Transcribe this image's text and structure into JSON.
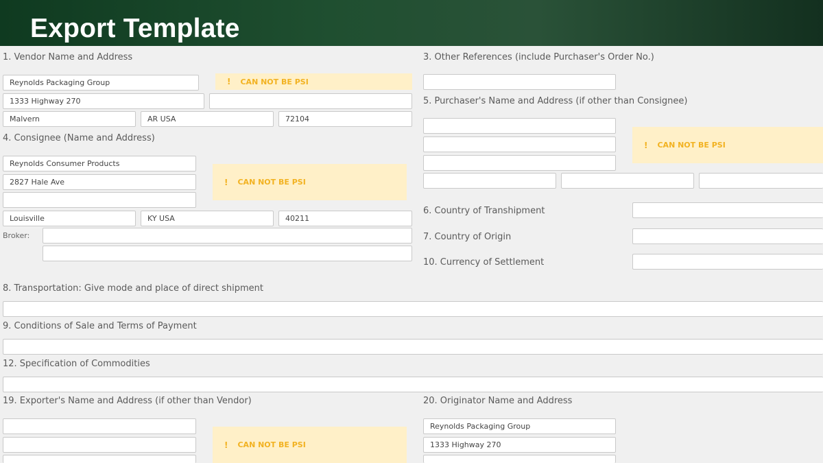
{
  "header": {
    "title": "Export Template"
  },
  "warning_text": "CAN NOT BE PSI",
  "warning_icon": "!",
  "labels": {
    "vendor": "1. Vendor Name and Address",
    "other_refs": "3. Other References (include Purchaser's Order No.)",
    "purchaser": "5. Purchaser's Name and Address (if other than Consignee)",
    "consignee": "4. Consignee (Name and Address)",
    "broker": "Broker:",
    "transhipment": "6. Country of Transhipment",
    "origin": "7. Country of Origin",
    "currency": "10. Currency of Settlement",
    "transportation": "8. Transportation: Give mode and place of direct shipment",
    "conditions": "9. Conditions of Sale and Terms of Payment",
    "specification": "12. Specification of Commodities",
    "exporter": "19. Exporter's Name and Address (if other than Vendor)",
    "originator": "20. Originator Name and Address"
  },
  "vendor": {
    "name": "Reynolds Packaging Group",
    "address1": "1333 Highway 270",
    "address2": "",
    "city": "Malvern",
    "state_country": "AR USA",
    "zip": "72104"
  },
  "consignee": {
    "name": "Reynolds Consumer Products",
    "address1": "2827 Hale Ave",
    "address2": "",
    "city": "Louisville",
    "state_country": "KY USA",
    "zip": "40211"
  },
  "broker": {
    "line1": "",
    "line2": ""
  },
  "other_refs": "",
  "purchaser": {
    "line1": "",
    "line2": "",
    "line3": "",
    "city": "",
    "state_country": "",
    "zip": ""
  },
  "transhipment": "",
  "origin": "",
  "currency": "",
  "transportation": "",
  "conditions": "",
  "specification": "",
  "exporter": {
    "line1": "",
    "line2": "",
    "line3": ""
  },
  "originator": {
    "name": "Reynolds Packaging Group",
    "address1": "1333 Highway 270",
    "address2": ""
  }
}
